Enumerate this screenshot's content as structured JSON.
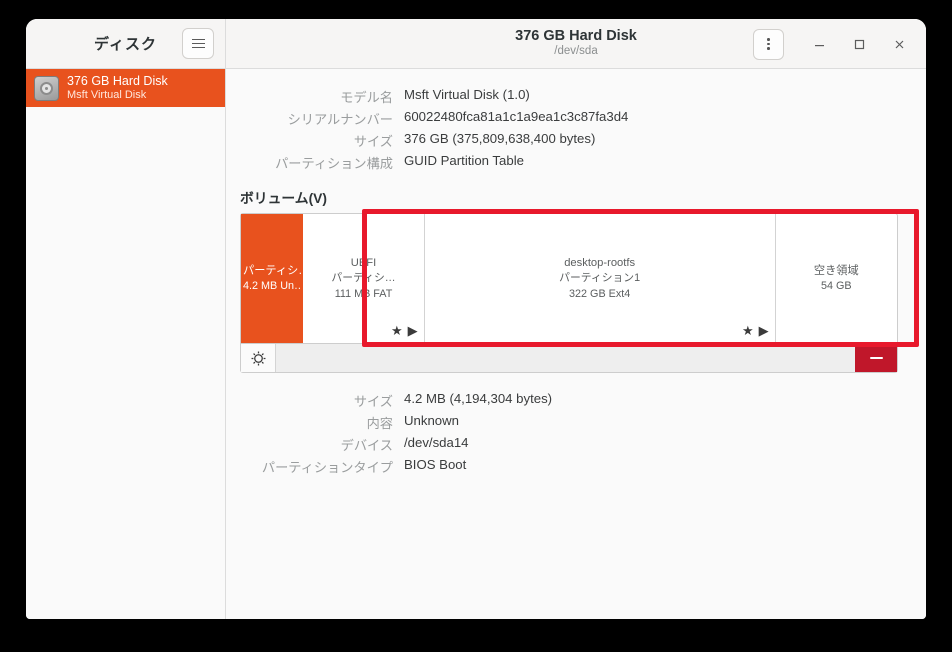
{
  "sidebar": {
    "title": "ディスク",
    "menu_icon": "hamburger-icon",
    "disk": {
      "icon": "hard-disk-icon",
      "name": "376 GB Hard Disk",
      "subtitle": "Msft Virtual Disk"
    }
  },
  "header": {
    "title": "376 GB Hard Disk",
    "subtitle": "/dev/sda",
    "kebab_icon": "kebab-menu-icon",
    "minimize_icon": "minimize-icon",
    "maximize_icon": "maximize-icon",
    "close_icon": "close-icon"
  },
  "disk_info": [
    {
      "label": "モデル名",
      "value": "Msft Virtual Disk (1.0)"
    },
    {
      "label": "シリアルナンバー",
      "value": "60022480fca81a1c1a9ea1c3c87fa3d4"
    },
    {
      "label": "サイズ",
      "value": "376 GB (375,809,638,400 bytes)"
    },
    {
      "label": "パーティション構成",
      "value": "GUID Partition Table"
    }
  ],
  "volumes": {
    "section_title": "ボリューム(V)",
    "segments": [
      {
        "line1": "パーティシ…",
        "line2": "4.2 MB Un…",
        "line3": "",
        "selected": true,
        "width_pct": 9.5,
        "flags": []
      },
      {
        "line1": "UEFI",
        "line2": "パーティシ…",
        "line3": "111 MB FAT",
        "selected": false,
        "width_pct": 18.5,
        "flags": [
          "star-icon",
          "play-icon"
        ]
      },
      {
        "line1": "desktop-rootfs",
        "line2": "パーティション1",
        "line3": "322 GB Ext4",
        "selected": false,
        "width_pct": 53.5,
        "flags": [
          "star-icon",
          "play-icon"
        ]
      },
      {
        "line1": "空き領域",
        "line2": "54 GB",
        "line3": "",
        "selected": false,
        "width_pct": 18.5,
        "flags": []
      }
    ],
    "toolbar": {
      "gear_icon": "gear-icon",
      "delete_icon": "minus-icon"
    }
  },
  "partition_details": [
    {
      "label": "サイズ",
      "value": "4.2 MB (4,194,304 bytes)"
    },
    {
      "label": "内容",
      "value": "Unknown"
    },
    {
      "label": "デバイス",
      "value": "/dev/sda14"
    },
    {
      "label": "パーティションタイプ",
      "value": "BIOS Boot"
    }
  ],
  "annotation": {
    "shape": "rectangle-highlight",
    "color": "#e8192c"
  },
  "colors": {
    "accent": "#e8521e",
    "annotation": "#e8192c",
    "delete_button": "#c0172a"
  }
}
